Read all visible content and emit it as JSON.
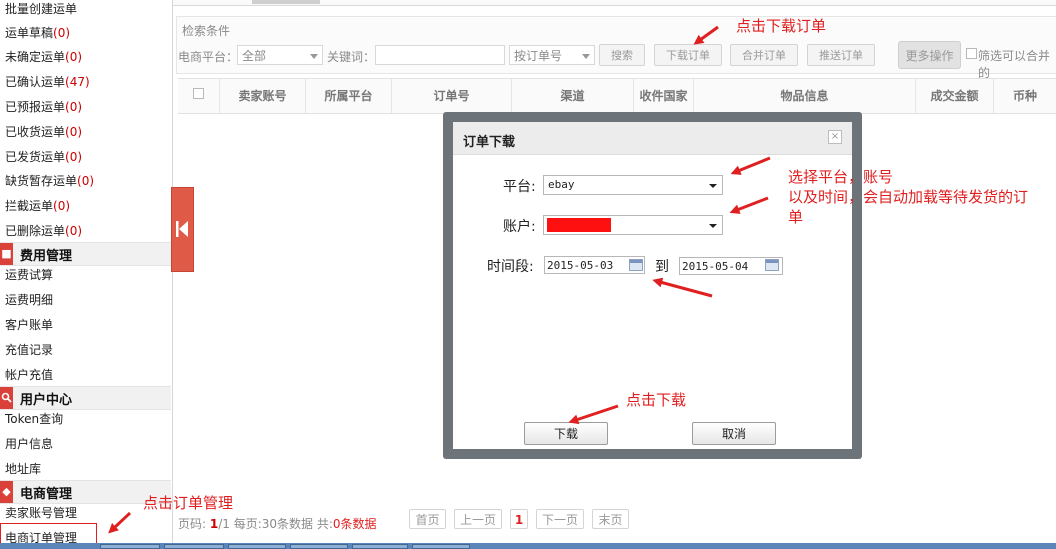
{
  "sidebar": {
    "items": [
      {
        "label": "批量创建运单",
        "count": ""
      },
      {
        "label": "运单草稿",
        "count": "(0)"
      },
      {
        "label": "未确定运单",
        "count": "(0)"
      },
      {
        "label": "已确认运单",
        "count": "(47)"
      },
      {
        "label": "已预报运单",
        "count": "(0)"
      },
      {
        "label": "已收货运单",
        "count": "(0)"
      },
      {
        "label": "已发货运单",
        "count": "(0)"
      },
      {
        "label": "缺货暂存运单",
        "count": "(0)"
      },
      {
        "label": "拦截运单",
        "count": "(0)"
      },
      {
        "label": "已删除运单",
        "count": "(0)"
      }
    ],
    "sections": [
      {
        "title": "费用管理",
        "icon": "fee-icon",
        "items": [
          "运费试算",
          "运费明细",
          "客户账单",
          "充值记录",
          "帐户充值"
        ]
      },
      {
        "title": "用户中心",
        "icon": "search-user-icon",
        "items": [
          "Token查询",
          "用户信息",
          "地址库"
        ]
      },
      {
        "title": "电商管理",
        "icon": "ecommerce-icon",
        "items": [
          "卖家账号管理",
          "电商订单管理"
        ]
      }
    ]
  },
  "search": {
    "title": "检索条件",
    "platform_label": "电商平台：",
    "platform_value": "全部",
    "keyword_label": "关键词：",
    "keyword_value": "",
    "order_type_value": "按订单号",
    "search_btn": "搜索",
    "download_btn": "下载订单",
    "merge_btn": "合并订单",
    "push_btn": "推送订单",
    "more_btn": "更多操作",
    "filter_text": "筛选可以合并的"
  },
  "grid": {
    "columns": [
      "卖家账号",
      "所属平台",
      "订单号",
      "渠道",
      "收件国家",
      "物品信息",
      "成交金额",
      "币种"
    ]
  },
  "dialog": {
    "title": "订单下载",
    "close": "×",
    "platform_label": "平台:",
    "platform_value": "ebay",
    "account_label": "账户:",
    "period_label": "时间段:",
    "date_from": "2015-05-03",
    "to_label": "到",
    "date_to": "2015-05-04",
    "download_btn": "下载",
    "cancel_btn": "取消"
  },
  "pager": {
    "text_prefix": "页码: ",
    "page_current": "1",
    "page_sep": "/1 每页:30条数据 共:",
    "total": "0条数据",
    "first": "首页",
    "prev": "上一页",
    "current": "1",
    "next": "下一页",
    "last": "末页"
  },
  "annotations": {
    "click_download_order": "点击下载订单",
    "select_platform_line1": "选择平台，账号",
    "select_platform_line2": "以及时间，会自动加载等待发货的订",
    "select_platform_line3": "单",
    "click_download": "点击下载",
    "click_order_manage": "点击订单管理"
  },
  "colors": {
    "annotation": "#e02020",
    "count": "#cc0000",
    "collapse_tab": "#e05a48",
    "dialog_frame": "#6c7479",
    "redaction": "#ff1010"
  }
}
